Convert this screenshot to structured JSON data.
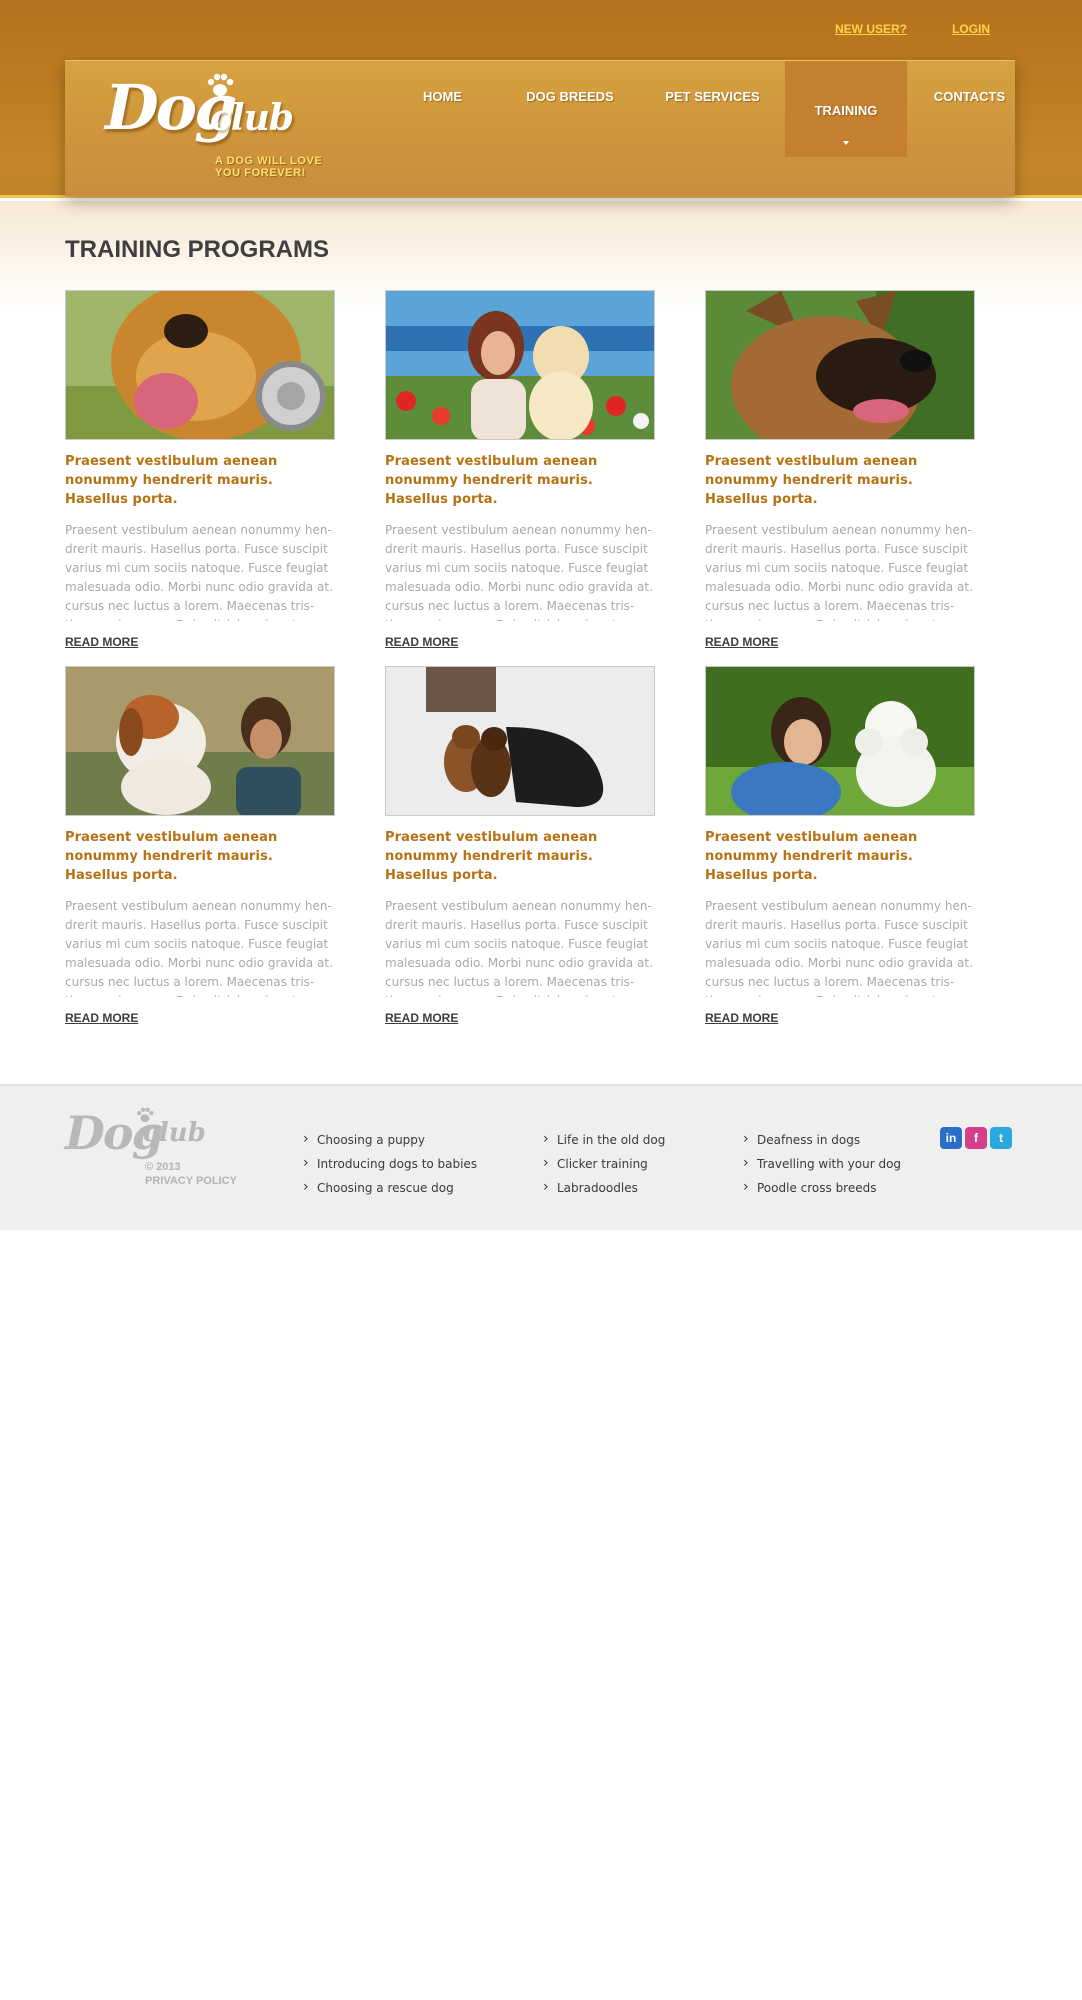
{
  "header": {
    "top_links": [
      "NEW USER?",
      "LOGIN"
    ],
    "logo": {
      "word1": "Dog",
      "word2": "club",
      "tagline_line1": "A DOG WILL LOVE",
      "tagline_line2": "YOU FOREVER!"
    },
    "nav": [
      {
        "label": "HOME"
      },
      {
        "label": "DOG BREEDS"
      },
      {
        "label": "PET SERVICES"
      },
      {
        "label": "TRAINING",
        "active": true
      },
      {
        "label": "CONTACTS"
      }
    ]
  },
  "main": {
    "title": "TRAINING PROGRAMS",
    "cards": [
      {
        "image": "dog-with-headphones-photo",
        "title": "Praesent vestibulum aenean nonummy hendrerit mauris. Hasellus porta.",
        "body": "Praesent vestibulum aenean nonummy hen-drerit mauris. Hasellus porta. Fusce suscipit varius mi cum sociis natoque. Fusce feugiat malesuada odio. Morbi nunc odio gravida at. cursus nec luctus a lorem. Maecenas tris-tique orci ac sem. Duis ultricies pharetra",
        "link": "READ MORE"
      },
      {
        "image": "woman-with-golden-puppy-photo",
        "title": "Praesent vestibulum aenean nonummy hendrerit mauris. Hasellus porta.",
        "body": "Praesent vestibulum aenean nonummy hen-drerit mauris. Hasellus porta. Fusce suscipit varius mi cum sociis natoque. Fusce feugiat malesuada odio. Morbi nunc odio gravida at. cursus nec luctus a lorem. Maecenas tris-tique orci ac sem. Duis ultricies pharetra",
        "link": "READ MORE"
      },
      {
        "image": "german-shepherd-photo",
        "title": "Praesent vestibulum aenean nonummy hendrerit mauris. Hasellus porta.",
        "body": "Praesent vestibulum aenean nonummy hen-drerit mauris. Hasellus porta. Fusce suscipit varius mi cum sociis natoque. Fusce feugiat malesuada odio. Morbi nunc odio gravida at. cursus nec luctus a lorem. Maecenas tris-tique orci ac sem. Duis ultricies pharetra",
        "link": "READ MORE"
      },
      {
        "image": "girl-with-beagle-photo",
        "title": "Praesent vestibulum aenean nonummy hendrerit mauris. Hasellus porta.",
        "body": "Praesent vestibulum aenean nonummy hen-drerit mauris. Hasellus porta. Fusce suscipit varius mi cum sociis natoque. Fusce feugiat malesuada odio. Morbi nunc odio gravida at. cursus nec luctus a lorem. Maecenas tris-tique orci ac sem. Duis ultricies pharetra",
        "link": "READ MORE"
      },
      {
        "image": "two-chihuahuas-photo",
        "title": "Praesent vestibulum aenean nonummy hendrerit mauris. Hasellus porta.",
        "body": "Praesent vestibulum aenean nonummy hen-drerit mauris. Hasellus porta. Fusce suscipit varius mi cum sociis natoque. Fusce feugiat malesuada odio. Morbi nunc odio gravida at. cursus nec luctus a lorem. Maecenas tris-tique orci ac sem. Duis ultricies pharetra",
        "link": "READ MORE"
      },
      {
        "image": "woman-with-poodle-photo",
        "title": "Praesent vestibulum aenean nonummy hendrerit mauris. Hasellus porta.",
        "body": "Praesent vestibulum aenean nonummy hen-drerit mauris. Hasellus porta. Fusce suscipit varius mi cum sociis natoque. Fusce feugiat malesuada odio. Morbi nunc odio gravida at. cursus nec luctus a lorem. Maecenas tris-tique orci ac sem. Duis ultricies pharetra",
        "link": "READ MORE"
      }
    ]
  },
  "footer": {
    "logo": {
      "word1": "Dog",
      "word2": "club"
    },
    "copyright": "© 2013",
    "privacy": "PRIVACY POLICY",
    "columns": [
      [
        "Choosing a puppy",
        "Introducing dogs to babies",
        "Choosing a rescue dog"
      ],
      [
        "Life in the old dog",
        "Clicker training",
        "Labradoodles"
      ],
      [
        "Deafness in dogs",
        "Travelling with your dog",
        "Poodle cross breeds"
      ]
    ],
    "social": [
      {
        "icon": "linkedin-icon",
        "glyph": "in",
        "color": "#2a6fc7"
      },
      {
        "icon": "facebook-icon",
        "glyph": "f",
        "color": "#d63f8c"
      },
      {
        "icon": "twitter-icon",
        "glyph": "t",
        "color": "#2aa9e0"
      }
    ]
  },
  "colors": {
    "header_orange": "#c07e22",
    "header_panel": "#d29a3c",
    "accent_yellow": "#ffd24a",
    "card_title": "#b77112",
    "body_text": "#a9a9a9",
    "footer_bg": "#efefef"
  }
}
